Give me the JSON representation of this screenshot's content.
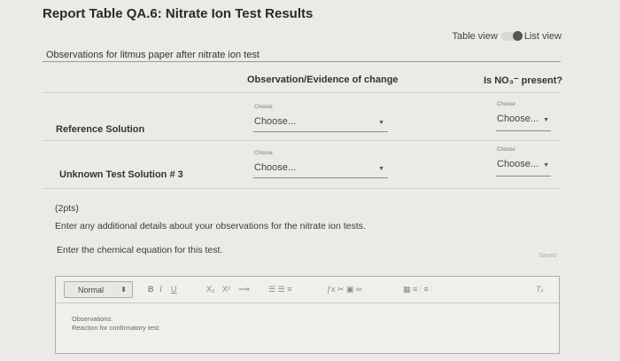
{
  "title": "Report Table QA.6: Nitrate Ion Test Results",
  "view_toggle": {
    "table_label": "Table view",
    "list_label": "List view"
  },
  "section": {
    "heading": "Observations for litmus paper after nitrate ion test"
  },
  "table": {
    "col_observation": "Observation/Evidence of change",
    "col_present": "Is NO₃⁻ present?",
    "rows": [
      {
        "label": "Reference Solution",
        "obs_small": "Choose",
        "obs_value": "Choose...",
        "present_small": "Choose",
        "present_value": "Choose..."
      },
      {
        "label": "Unknown Test Solution # 3",
        "obs_small": "Choose",
        "obs_value": "Choose...",
        "present_small": "Choose",
        "present_value": "Choose..."
      }
    ]
  },
  "question": {
    "points": "(2pts)",
    "prompt1": "Enter any additional details about your observations for the nitrate ion tests.",
    "prompt2": "Enter the chemical equation for this test."
  },
  "saved": "Saved",
  "editor": {
    "format": "Normal",
    "bold": "B",
    "italic": "I",
    "underline": "U",
    "subscript": "X₂",
    "superscript": "X²",
    "arrow": "⟶",
    "list_buttons": "☰ ☰ ≡",
    "insert_buttons": "ƒx ✂ ▣ ∞",
    "table_buttons": "▦ ≡ ⫶ ≡ ⫶",
    "clear": "Tₓ",
    "content_line1": "Observations:",
    "content_line2": "Reaction for confirmatory test:"
  },
  "colors": {
    "background": "#eceae7",
    "border": "#b0aeaa"
  }
}
